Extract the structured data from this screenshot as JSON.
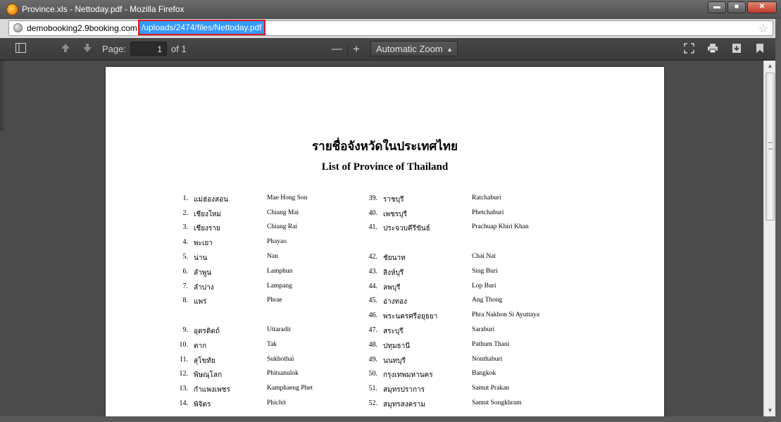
{
  "window": {
    "title": "Province.xls - Nettoday.pdf - Mozilla Firefox",
    "minimize_label": "▬",
    "maximize_label": "■",
    "close_label": "✕"
  },
  "urlbar": {
    "domain": "demobooking2.9booking.com",
    "path": "/uploads/2474/files/Nettoday.pdf"
  },
  "pdf_toolbar": {
    "page_label": "Page:",
    "page_value": "1",
    "page_total": "of 1",
    "zoom_out": "—",
    "zoom_in": "+",
    "zoom_value": "Automatic Zoom"
  },
  "document": {
    "title_thai": "รายชื่อจังหวัดในประเทศไทย",
    "title_english": "List of Province of Thailand",
    "left_column": [
      {
        "num": "1.",
        "thai": "แม่ฮ่องสอน",
        "english": "Mae Hong Son"
      },
      {
        "num": "2.",
        "thai": "เชียงใหม่",
        "english": "Chiang Mai"
      },
      {
        "num": "3.",
        "thai": "เชียงราย",
        "english": "Chiang Rai"
      },
      {
        "num": "4.",
        "thai": "พะเยา",
        "english": "Phayao"
      },
      {
        "num": "5.",
        "thai": "น่าน",
        "english": "Nan"
      },
      {
        "num": "6.",
        "thai": "ลำพูน",
        "english": "Lamphun"
      },
      {
        "num": "7.",
        "thai": "ลำปาง",
        "english": "Lampang"
      },
      {
        "num": "8.",
        "thai": "แพร่",
        "english": "Phrae"
      },
      {
        "num": "9.",
        "thai": "อุตรดิตถ์",
        "english": "Uttaradit"
      },
      {
        "num": "10.",
        "thai": "ตาก",
        "english": "Tak"
      },
      {
        "num": "11.",
        "thai": "สุโขทัย",
        "english": "Sukhothai"
      },
      {
        "num": "12.",
        "thai": "พิษณุโลก",
        "english": "Phitsanulok"
      },
      {
        "num": "13.",
        "thai": "กำแพงเพชร",
        "english": "Kamphaeng Phet"
      },
      {
        "num": "14.",
        "thai": "พิจิตร",
        "english": "Phichit"
      }
    ],
    "right_column": [
      {
        "num": "39.",
        "thai": "ราชบุรี",
        "english": "Ratchaburi"
      },
      {
        "num": "40.",
        "thai": "เพชรบุรี",
        "english": "Phetchaburi"
      },
      {
        "num": "41.",
        "thai": "ประจวบคีรีขันธ์",
        "english": "Prachuap Khiri Khan"
      },
      {
        "num": "42.",
        "thai": "ชัยนาท",
        "english": "Chai Nat"
      },
      {
        "num": "43.",
        "thai": "สิงห์บุรี",
        "english": "Sing Buri"
      },
      {
        "num": "44.",
        "thai": "ลพบุรี",
        "english": "Lop Buri"
      },
      {
        "num": "45.",
        "thai": "อ่างทอง",
        "english": "Ang Thong"
      },
      {
        "num": "46.",
        "thai": "พระนครศรีอยุธยา",
        "english": "Phra Nakhon Si Ayuttaya"
      },
      {
        "num": "47.",
        "thai": "สระบุรี",
        "english": "Saraburi"
      },
      {
        "num": "48.",
        "thai": "ปทุมธานี",
        "english": "Pathum Thani"
      },
      {
        "num": "49.",
        "thai": "นนทบุรี",
        "english": "Nonthaburi"
      },
      {
        "num": "50.",
        "thai": "กรุงเทพมหานคร",
        "english": "Bangkok"
      },
      {
        "num": "51.",
        "thai": "สมุทรปราการ",
        "english": "Samut Prakan"
      },
      {
        "num": "52.",
        "thai": "สมุทรสงคราม",
        "english": "Samut Songkhram"
      }
    ]
  }
}
